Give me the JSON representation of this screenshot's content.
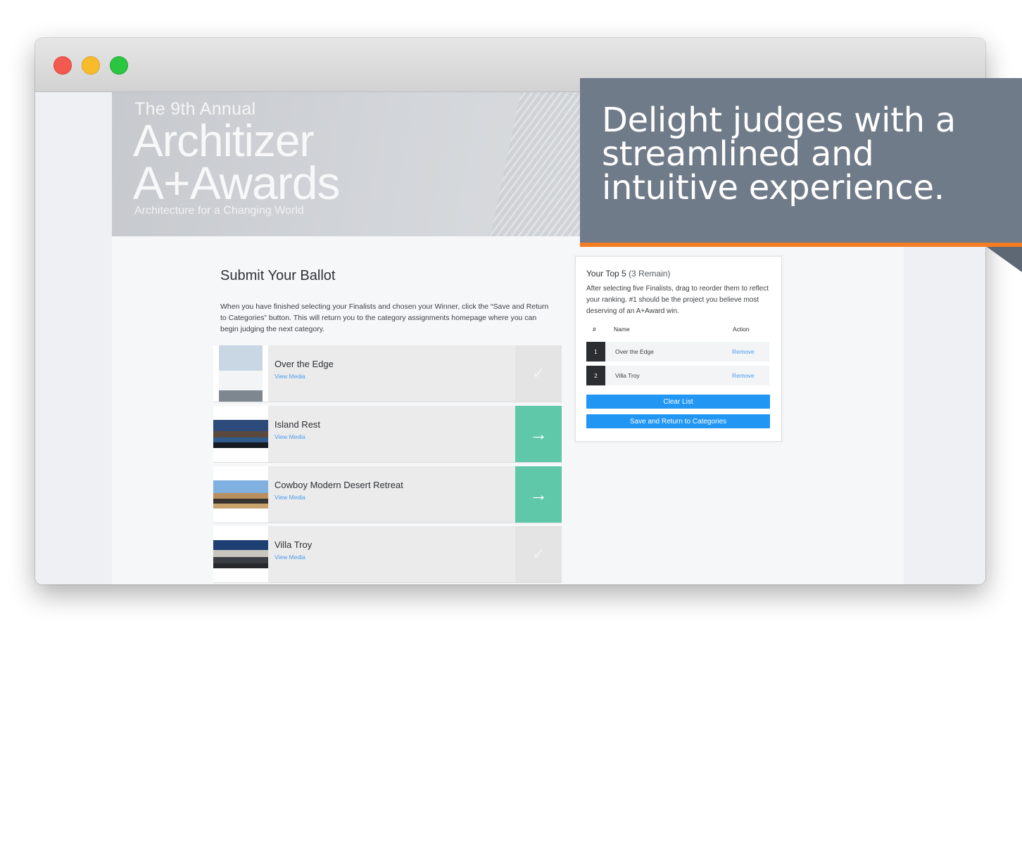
{
  "hero": {
    "pretitle": "The 9th Annual",
    "brand": "Architizer",
    "awards": "A+Awards",
    "tagline": "Architecture for a Changing World"
  },
  "ballot": {
    "title": "Submit Your Ballot",
    "description": "When you have finished selecting your Finalists and chosen your Winner, click the “Save and Return to Categories” button. This will return you to the category assignments homepage where you can begin judging the next category."
  },
  "finalists": [
    {
      "name": "Over the Edge",
      "link": "View Media",
      "action": "check",
      "selected": true
    },
    {
      "name": "Island Rest",
      "link": "View Media",
      "action": "arrow",
      "selected": false
    },
    {
      "name": "Cowboy Modern Desert Retreat",
      "link": "View Media",
      "action": "arrow",
      "selected": false
    },
    {
      "name": "Villa Troy",
      "link": "View Media",
      "action": "check",
      "selected": true
    }
  ],
  "top5": {
    "title": "Your Top 5",
    "remaining": "(3 Remain)",
    "description": "After selecting five Finalists, drag to reorder them to reflect your ranking. #1 should be the project you believe most deserving of an A+Award win.",
    "columns": [
      "#",
      "Name",
      "Action"
    ],
    "rows": [
      {
        "rank": "1",
        "name": "Over the Edge",
        "action": "Remove"
      },
      {
        "rank": "2",
        "name": "Villa Troy",
        "action": "Remove"
      }
    ],
    "clear_label": "Clear List",
    "save_label": "Save and Return to Categories"
  },
  "callout": {
    "text": "Delight judges with a streamlined and intuitive experience."
  },
  "icons": {
    "check": "✓",
    "arrow": "→"
  },
  "colors": {
    "accent": "#f57c22",
    "callout": "#6f7b89",
    "button": "#2196f3",
    "go": "#5fc8a8"
  }
}
